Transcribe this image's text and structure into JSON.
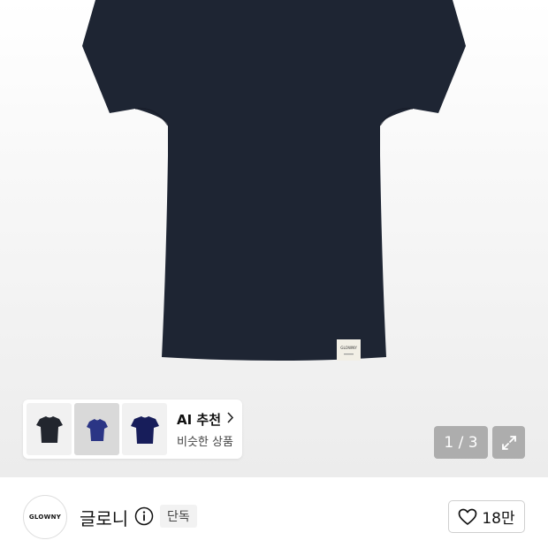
{
  "product_image": {
    "label_text": "GLOWNY",
    "colors": {
      "shirt": "#1e2533",
      "label": "#f2efe6"
    }
  },
  "ai_recommend": {
    "title": "AI 추천",
    "chevron": "chevron-right-icon",
    "subtitle": "비슷한 상품",
    "thumbnails": [
      {
        "name": "thumb-black-tshirt",
        "color": "#22262e"
      },
      {
        "name": "thumb-royal-tshirt",
        "color": "#2b3585"
      },
      {
        "name": "thumb-navy-tshirt",
        "color": "#171d5a"
      }
    ]
  },
  "gallery": {
    "counter": "1 / 3",
    "current": 1,
    "total": 3,
    "expand_icon": "expand-icon"
  },
  "brand": {
    "logo_text": "GLOWNY",
    "name": "글로니",
    "info_icon": "info-icon",
    "badge": "단독"
  },
  "like": {
    "icon": "heart-icon",
    "count": "18만"
  }
}
